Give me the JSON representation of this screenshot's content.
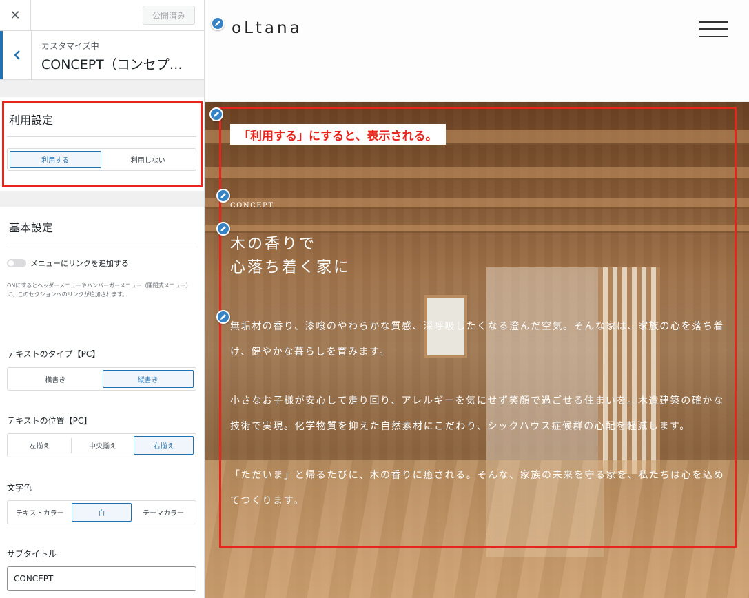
{
  "header": {
    "close_glyph": "✕",
    "publish_label": "公開済み"
  },
  "breadcrumb": {
    "back_glyph": "‹",
    "subtitle": "カスタマイズ中",
    "title": "CONCEPT（コンセプ…"
  },
  "usage": {
    "heading": "利用設定",
    "options": [
      "利用する",
      "利用しない"
    ],
    "selected": "利用する"
  },
  "basic": {
    "heading": "基本設定",
    "menu_link_label": "メニューにリンクを追加する",
    "menu_link_enabled": false,
    "help_text": "ONにするとヘッダーメニューやハンバーガーメニュー（開閉式メニュー）に、このセクションへのリンクが追加されます。",
    "text_type": {
      "label": "テキストのタイプ【PC】",
      "options": [
        "横書き",
        "縦書き"
      ],
      "selected": "縦書き"
    },
    "text_position": {
      "label": "テキストの位置【PC】",
      "options": [
        "左揃え",
        "中央揃え",
        "右揃え"
      ],
      "selected": "右揃え"
    },
    "text_color": {
      "label": "文字色",
      "options": [
        "テキストカラー",
        "白",
        "テーマカラー"
      ],
      "selected": "白"
    },
    "subtitle": {
      "label": "サブタイトル",
      "value": "CONCEPT"
    }
  },
  "preview": {
    "logo": "oLtana",
    "callout": "「利用する」にすると、表示される。",
    "concept_subtitle": "CONCEPT",
    "title_lines": [
      "木の香りで",
      "心落ち着く家に"
    ],
    "paragraphs": [
      "無垢材の香り、漆喰のやわらかな質感、深呼吸したくなる澄んだ空気。そんな家は、家族の心を落ち着け、健やかな暮らしを育みます。",
      "小さなお子様が安心して走り回り、アレルギーを気にせず笑顔で過ごせる住まいを。木造建築の確かな技術で実現。化学物質を抑えた自然素材にこだわり、シックハウス症候群の心配を軽減します。",
      "「ただいま」と帰るたびに、木の香りに癒される。そんな、家族の未来を守る家を、私たちは心を込めてつくります。"
    ]
  },
  "colors": {
    "accent": "#2271b1",
    "annotation_red": "#e8251c",
    "edit_icon": "#3582c4"
  }
}
